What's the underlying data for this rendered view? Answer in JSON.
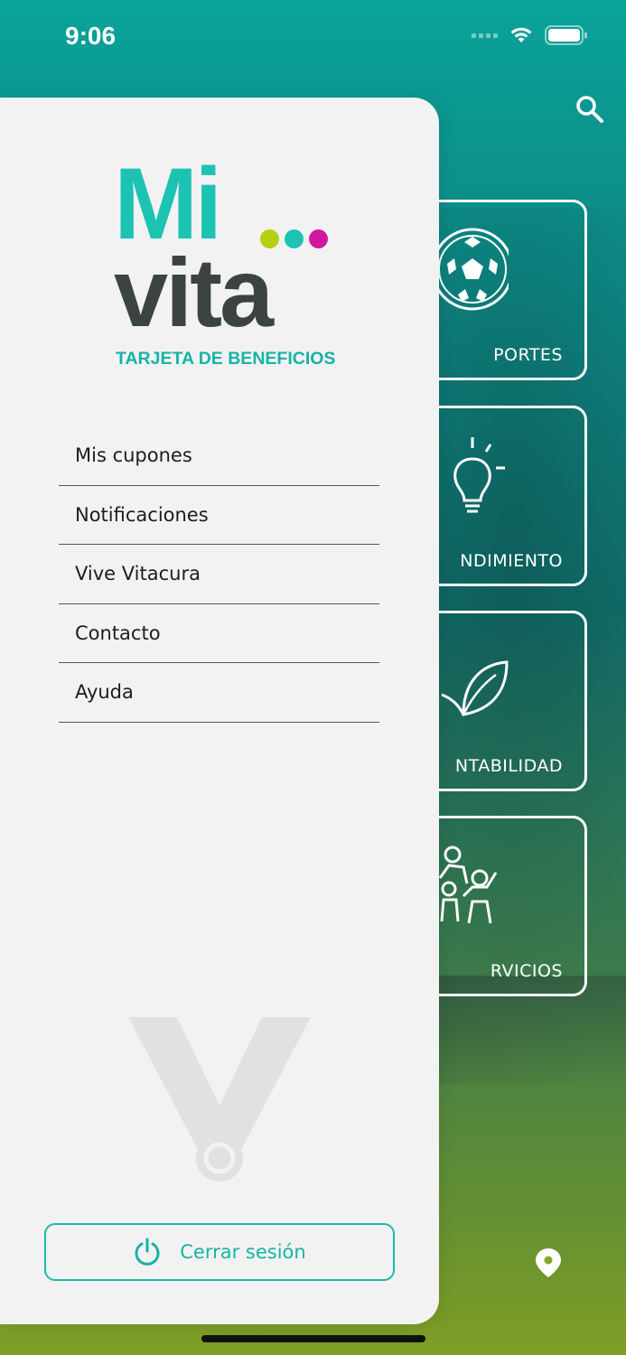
{
  "status_bar": {
    "time": "9:06"
  },
  "header": {
    "search_icon": "search-icon"
  },
  "categories": [
    {
      "label": "PORTES",
      "icon": "soccer-ball-icon"
    },
    {
      "label": "NDIMIENTO",
      "icon": "lightbulb-icon"
    },
    {
      "label": "NTABILIDAD",
      "icon": "leaf-icon"
    },
    {
      "label": "RVICIOS",
      "icon": "family-icon"
    }
  ],
  "drawer": {
    "logo": {
      "line1": "Mi",
      "line2": "vita",
      "tagline": "TARJETA DE BENEFICIOS"
    },
    "menu": [
      {
        "label": "Mis cupones"
      },
      {
        "label": "Notificaciones"
      },
      {
        "label": "Vive Vitacura"
      },
      {
        "label": "Contacto"
      },
      {
        "label": "Ayuda"
      }
    ],
    "logout_label": "Cerrar sesión"
  },
  "colors": {
    "accent": "#1cc3b3",
    "logo_dark": "#3b4443",
    "dot_green": "#b8cf0f",
    "dot_teal": "#1cc3b3",
    "dot_magenta": "#d3169e"
  }
}
